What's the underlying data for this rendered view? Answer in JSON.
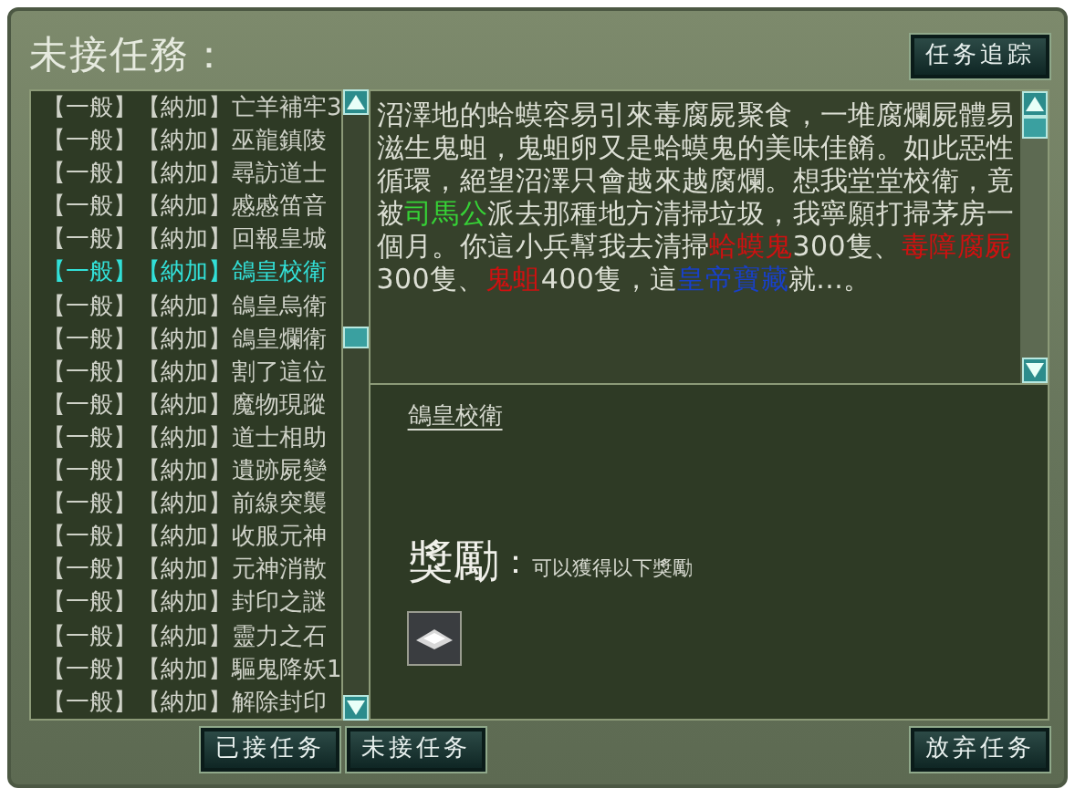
{
  "window": {
    "title": "未接任務：",
    "track_button": "任务追踪"
  },
  "quests": [
    {
      "category": "【一般】",
      "region": "【納加】",
      "name": "亡羊補牢3",
      "selected": false
    },
    {
      "category": "【一般】",
      "region": "【納加】",
      "name": "巫龍鎮陵",
      "selected": false
    },
    {
      "category": "【一般】",
      "region": "【納加】",
      "name": "尋訪道士",
      "selected": false
    },
    {
      "category": "【一般】",
      "region": "【納加】",
      "name": "慼慼笛音",
      "selected": false
    },
    {
      "category": "【一般】",
      "region": "【納加】",
      "name": "回報皇城",
      "selected": false
    },
    {
      "category": "【一般】",
      "region": "【納加】",
      "name": "鴿皇校衛",
      "selected": true
    },
    {
      "category": "【一般】",
      "region": "【納加】",
      "name": "鴿皇烏衛",
      "selected": false
    },
    {
      "category": "【一般】",
      "region": "【納加】",
      "name": "鴿皇爛衛",
      "selected": false
    },
    {
      "category": "【一般】",
      "region": "【納加】",
      "name": "割了這位",
      "selected": false
    },
    {
      "category": "【一般】",
      "region": "【納加】",
      "name": "魔物現蹤",
      "selected": false
    },
    {
      "category": "【一般】",
      "region": "【納加】",
      "name": "道士相助",
      "selected": false
    },
    {
      "category": "【一般】",
      "region": "【納加】",
      "name": "遺跡屍變",
      "selected": false
    },
    {
      "category": "【一般】",
      "region": "【納加】",
      "name": "前線突襲",
      "selected": false
    },
    {
      "category": "【一般】",
      "region": "【納加】",
      "name": "收服元神",
      "selected": false
    },
    {
      "category": "【一般】",
      "region": "【納加】",
      "name": "元神消散",
      "selected": false
    },
    {
      "category": "【一般】",
      "region": "【納加】",
      "name": "封印之謎",
      "selected": false
    },
    {
      "category": "【一般】",
      "region": "【納加】",
      "name": "靈力之石",
      "selected": false
    },
    {
      "category": "【一般】",
      "region": "【納加】",
      "name": "驅鬼降妖1",
      "selected": false
    },
    {
      "category": "【一般】",
      "region": "【納加】",
      "name": "解除封印",
      "selected": false
    }
  ],
  "description": [
    {
      "kind": "plain",
      "text": "沼澤地的蛤蟆容易引來毒腐屍聚食，一堆腐爛屍體易滋生鬼蛆，鬼蛆卵又是蛤蟆鬼的美味佳餚。如此惡性循環，絕望沼澤只會越來越腐爛。想我堂堂校衛，竟被"
    },
    {
      "kind": "npc",
      "text": "司馬公"
    },
    {
      "kind": "plain",
      "text": "派去那種地方清掃垃圾，我寧願打掃茅房一個月。你這小兵幫我去清掃"
    },
    {
      "kind": "monster",
      "text": "蛤蟆鬼"
    },
    {
      "kind": "plain",
      "text": "300隻、"
    },
    {
      "kind": "monster",
      "text": "毒障腐屍"
    },
    {
      "kind": "plain",
      "text": "300隻、"
    },
    {
      "kind": "monster",
      "text": "鬼蛆"
    },
    {
      "kind": "plain",
      "text": "400隻，這"
    },
    {
      "kind": "item",
      "text": "皇帝寶藏"
    },
    {
      "kind": "plain",
      "text": "就...。"
    }
  ],
  "quest_title": "鴿皇校衛",
  "reward": {
    "label": "獎勵",
    "colon": "：",
    "note": "可以獲得以下獎勵"
  },
  "footer_left": [
    "已接任务",
    "未接任务"
  ],
  "footer_right": [
    "放弃任务"
  ]
}
